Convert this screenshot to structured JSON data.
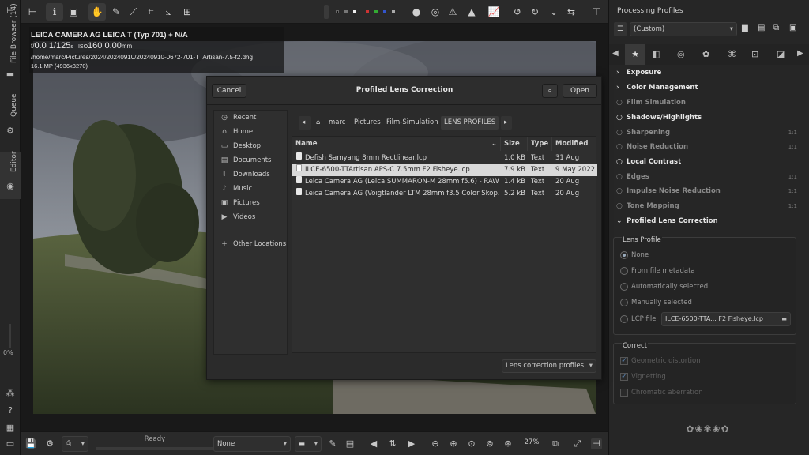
{
  "left_tabs": {
    "file_browser": "File Browser (14)",
    "queue": "Queue",
    "editor": "Editor",
    "zoom_percent": "0%"
  },
  "info": {
    "camera": "LEICA CAMERA AG LEICA T (Typ 701) + N/A",
    "exposure_f": "f/",
    "exposure_aperture": "0.0",
    "exposure_shutter": "1/125",
    "exposure_shutter_unit": "s",
    "exposure_iso_label": "ISO",
    "exposure_iso": "160",
    "exposure_focal": "0.00",
    "exposure_focal_unit": "mm",
    "path": "/home/marc/Pictures/2024/20240910/20240910-0672-701-TTArtisan-7.5-f2.dng",
    "size": "16.1 MP (4936x3270)"
  },
  "bottom": {
    "status": "Ready",
    "preview_combo": "None",
    "zoom": "27%"
  },
  "right_panel": {
    "title": "Processing Profiles",
    "profile": "(Custom)",
    "tools": [
      {
        "label": "Exposure",
        "badge": ""
      },
      {
        "label": "Color Management",
        "badge": ""
      },
      {
        "label": "Film Simulation",
        "badge": ""
      },
      {
        "label": "Shadows/Highlights",
        "badge": ""
      },
      {
        "label": "Sharpening",
        "badge": "1:1"
      },
      {
        "label": "Noise Reduction",
        "badge": "1:1"
      },
      {
        "label": "Local Contrast",
        "badge": ""
      },
      {
        "label": "Edges",
        "badge": "1:1"
      },
      {
        "label": "Impulse Noise Reduction",
        "badge": "1:1"
      },
      {
        "label": "Tone Mapping",
        "badge": "1:1"
      },
      {
        "label": "Profiled Lens Correction",
        "badge": ""
      }
    ],
    "lens_profile": {
      "title": "Lens Profile",
      "none": "None",
      "from_metadata": "From file metadata",
      "auto": "Automatically selected",
      "manual": "Manually selected",
      "lcp_label": "LCP file",
      "lcp_value": "ILCE-6500-TTA... F2 Fisheye.lcp"
    },
    "correct": {
      "title": "Correct",
      "geometric": "Geometric distortion",
      "vignetting": "Vignetting",
      "chromatic": "Chromatic aberration"
    }
  },
  "dialog": {
    "title": "Profiled Lens Correction",
    "cancel": "Cancel",
    "open": "Open",
    "places": [
      "Recent",
      "Home",
      "Desktop",
      "Documents",
      "Downloads",
      "Music",
      "Pictures",
      "Videos"
    ],
    "other_locations": "Other Locations",
    "path": [
      "marc",
      "Pictures",
      "Film-Simulation",
      "LENS PROFILES"
    ],
    "columns": {
      "name": "Name",
      "size": "Size",
      "type": "Type",
      "modified": "Modified"
    },
    "files": [
      {
        "name": "Defish Samyang 8mm Rectlinear.lcp",
        "size": "1.0 kB",
        "type": "Text",
        "modified": "31 Aug"
      },
      {
        "name": "ILCE-6500-TTArtisan APS-C 7.5mm F2 Fisheye.lcp",
        "size": "7.9 kB",
        "type": "Text",
        "modified": "9 May 2022"
      },
      {
        "name": "Leica Camera AG (Leica SUMMARON-M 28mm f5.6) - RAW...",
        "size": "1.4 kB",
        "type": "Text",
        "modified": "20 Aug"
      },
      {
        "name": "Leica Camera AG (Voigtlander LTM 28mm f3.5 Color Skop...",
        "size": "5.2 kB",
        "type": "Text",
        "modified": "20 Aug"
      }
    ],
    "filter": "Lens correction profiles"
  }
}
